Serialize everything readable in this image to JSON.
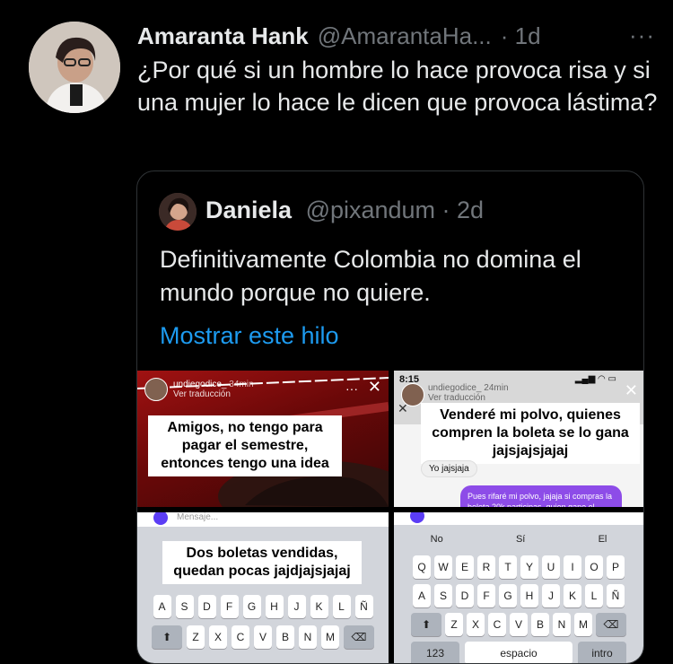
{
  "tweet": {
    "author_name": "Amaranta Hank",
    "author_handle": "@AmarantaHa...",
    "time": "· 1d",
    "more": "···",
    "text": "¿Por qué si un hombre lo hace provoca risa y si una mujer lo hace le dicen que provoca lástima?"
  },
  "quote": {
    "author_name": "Daniela",
    "author_handle": "@pixandum · 2d",
    "text": "Definitivamente Colombia no domina el mundo porque no quiere.",
    "show_thread": "Mostrar este hilo"
  },
  "media": {
    "tile1": {
      "username": "undiegodice_",
      "age": "34min",
      "translate": "Ver traducción",
      "caption": "Amigos, no tengo para pagar el semestre, entonces tengo una idea"
    },
    "tile2": {
      "clock": "8:15",
      "username": "undiegodice_",
      "age": "24min",
      "translate": "Ver traducción",
      "caption": "Venderé mi polvo, quienes compren la boleta se lo gana jajsjajsjajaj",
      "reply": "Yo jajsjaja",
      "bubble": "Pues rifaré mi polvo, jajaja si compras la boleta 20k participas, quien gane el"
    },
    "tile3": {
      "placeholder": "Mensaje...",
      "caption": "Dos boletas vendidas, quedan pocas jajdjajsjajaj",
      "row2": [
        "A",
        "S",
        "D",
        "F",
        "G",
        "H",
        "J",
        "K",
        "L",
        "Ñ"
      ],
      "row3": [
        "Z",
        "X",
        "C",
        "V",
        "B",
        "N",
        "M"
      ]
    },
    "tile4": {
      "suggestions": [
        "No",
        "Sí",
        "El"
      ],
      "row1": [
        "Q",
        "W",
        "E",
        "R",
        "T",
        "Y",
        "U",
        "I",
        "O",
        "P"
      ],
      "row2": [
        "A",
        "S",
        "D",
        "F",
        "G",
        "H",
        "J",
        "K",
        "L",
        "Ñ"
      ],
      "row3": [
        "Z",
        "X",
        "C",
        "V",
        "B",
        "N",
        "M"
      ],
      "key_123": "123",
      "key_space": "espacio",
      "key_intro": "intro"
    }
  },
  "colors": {
    "background": "#000000",
    "text": "#e7e9ea",
    "muted": "#71767b",
    "link": "#1d9bf0",
    "border": "#2f3336"
  }
}
